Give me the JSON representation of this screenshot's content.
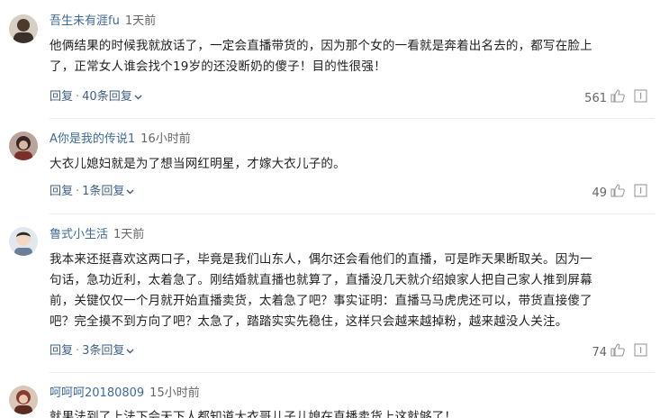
{
  "comments": [
    {
      "username": "吾生未有涯fu",
      "time": "1天前",
      "text_lines": [
        "他俩结果的时候我就放话了，一定会直播带货的，因为那个女的一看就是奔着出名去的，都写在脸上",
        "了，正常女人谁会找个19岁的还没断奶的傻子！目的性很强！"
      ],
      "reply_label": "回复",
      "reply_count": "40条回复",
      "likes": "561",
      "avatar_color": "#4a3b2e"
    },
    {
      "username": "A你是我的传说1",
      "time": "16小时前",
      "text_lines": [
        "大衣儿媳妇就是为了想当网红明星，才嫁大衣儿子的。"
      ],
      "reply_label": "回复",
      "reply_count": "1条回复",
      "likes": "49",
      "avatar_color": "#3a2420"
    },
    {
      "username": "鲁式小生活",
      "time": "1天前",
      "text_lines": [
        "我本来还挺喜欢这两口子，毕竟是我们山东人，偶尔还会看他们的直播，可是昨天果断取关。因为一",
        "句话，急功近利，太着急了。刚结婚就直播也就算了，直播没几天就介绍娘家人把自己家人推到屏幕",
        "前，关键仅仅一个月就开始直播卖货，太着急了吧？事实证明：直播马马虎虎还可以，带货直接傻了",
        "吧？完全摸不到方向了吧？太急了，踏踏实实先稳住，这样只会越来越掉粉，越来越没人关注。"
      ],
      "reply_label": "回复",
      "reply_count": "3条回复",
      "likes": "74",
      "avatar_color": "#6a7f96"
    },
    {
      "username": "呵呵呵20180809",
      "time": "15小时前",
      "text_lines": [
        "就果法到了上法下会天下人都知道大衣哥儿子儿媳在直播卖货上这就够了！"
      ],
      "avatar_color": "#8a3a2c"
    }
  ],
  "separator": "·",
  "icons": {
    "like": "thumbs-up-icon",
    "report": "report-icon",
    "chevron": "chevron-down-icon"
  }
}
